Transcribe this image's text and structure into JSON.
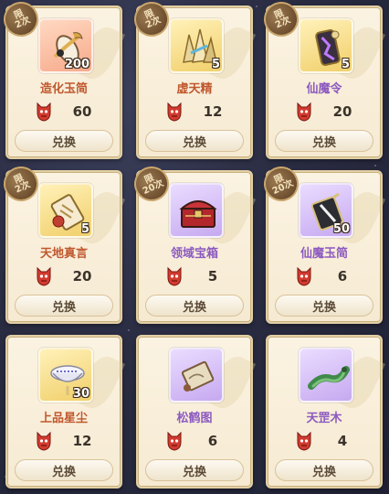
{
  "currency_icon": "demon-mask-icon",
  "currency_color": "#d23b2f",
  "cards": [
    {
      "name": "造化玉简",
      "qty": "200",
      "price": "60",
      "redeem": "兑换",
      "limit": [
        "限",
        "2次"
      ],
      "quality": "orange",
      "icon": "jade-scroll-icon"
    },
    {
      "name": "虚天精",
      "qty": "5",
      "price": "12",
      "redeem": "兑换",
      "limit": [
        "限",
        "2次"
      ],
      "quality": "gold",
      "icon": "crystal-cluster-icon"
    },
    {
      "name": "仙魔令",
      "qty": "5",
      "price": "20",
      "redeem": "兑换",
      "limit": [
        "限",
        "2次"
      ],
      "quality": "gold",
      "icon": "purple-token-icon"
    },
    {
      "name": "天地真言",
      "qty": "5",
      "price": "20",
      "redeem": "兑换",
      "limit": [
        "限",
        "2次"
      ],
      "quality": "gold",
      "icon": "scroll-icon"
    },
    {
      "name": "领域宝箱",
      "qty": "",
      "price": "5",
      "redeem": "兑换",
      "limit": [
        "限",
        "20次"
      ],
      "quality": "purple",
      "icon": "red-chest-icon"
    },
    {
      "name": "仙魔玉简",
      "qty": "50",
      "price": "6",
      "redeem": "兑换",
      "limit": [
        "限",
        "20次"
      ],
      "quality": "purple",
      "icon": "dark-jade-slip-icon"
    },
    {
      "name": "上品星尘",
      "qty": "30",
      "price": "12",
      "redeem": "兑换",
      "limit": null,
      "quality": "gold",
      "icon": "stardust-bowl-icon"
    },
    {
      "name": "松鹤图",
      "qty": "",
      "price": "6",
      "redeem": "兑换",
      "limit": null,
      "quality": "purple",
      "icon": "painting-scroll-icon"
    },
    {
      "name": "天罡木",
      "qty": "",
      "price": "4",
      "redeem": "兑换",
      "limit": null,
      "quality": "purple",
      "icon": "green-lizard-wood-icon"
    }
  ]
}
